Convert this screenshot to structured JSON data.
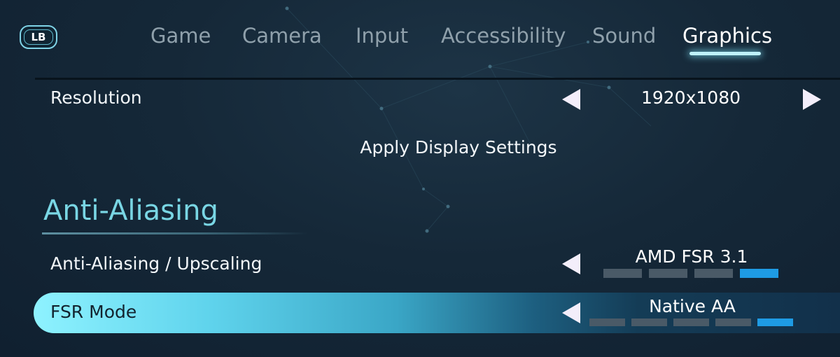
{
  "tabs": {
    "bumper_label": "LB",
    "items": [
      {
        "label": "Game"
      },
      {
        "label": "Camera"
      },
      {
        "label": "Input"
      },
      {
        "label": "Accessibility"
      },
      {
        "label": "Sound"
      },
      {
        "label": "Graphics"
      }
    ],
    "active_tab": "Graphics"
  },
  "settings": {
    "resolution": {
      "label": "Resolution",
      "value": "1920x1080"
    },
    "apply_label": "Apply Display Settings",
    "section_title": "Anti-Aliasing",
    "anti_aliasing": {
      "label": "Anti-Aliasing / Upscaling",
      "value": "AMD FSR 3.1",
      "option_count": 4,
      "selected_index": 3
    },
    "fsr_mode": {
      "label": "FSR Mode",
      "value": "Native AA",
      "option_count": 5,
      "selected_index": 4,
      "focused": true
    }
  },
  "colors": {
    "accent": "#79d6e4",
    "selected_segment": "#1e9be4",
    "unselected_segment": "#4a5a67",
    "focus_highlight": "#8ef2ff"
  }
}
